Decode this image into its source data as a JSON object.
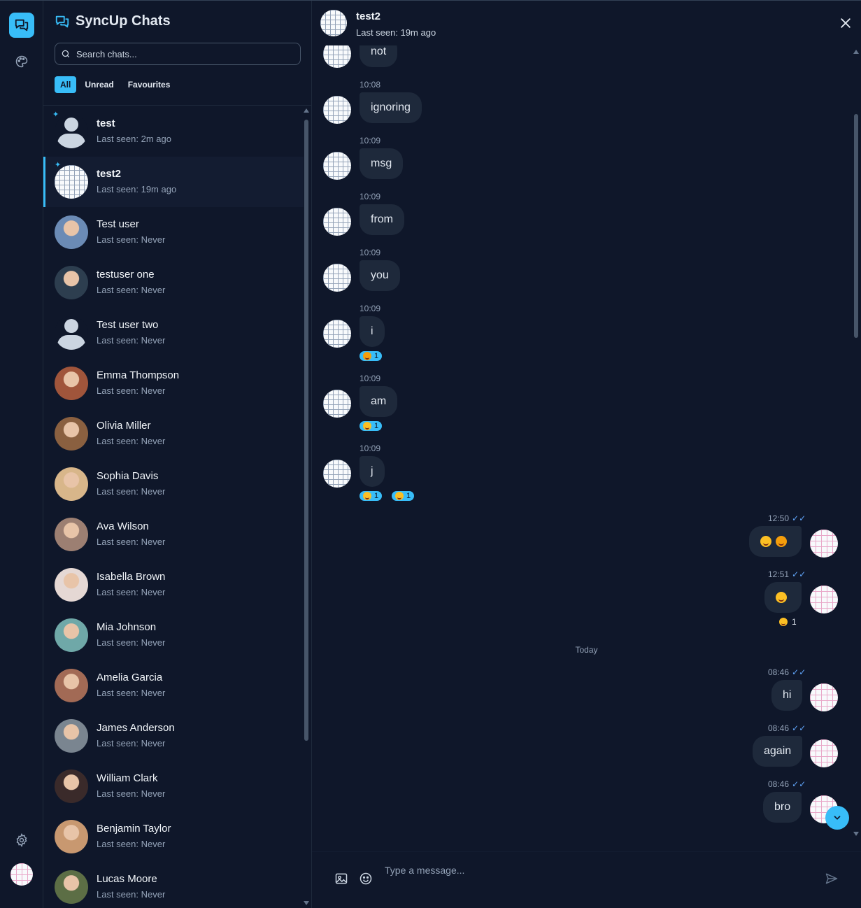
{
  "rail": {
    "items": [
      "chats-icon",
      "palette-icon",
      "settings-icon"
    ]
  },
  "sidebar": {
    "title": "SyncUp Chats",
    "search_placeholder": "Search chats...",
    "filters": [
      "All",
      "Unread",
      "Favourites"
    ],
    "chats": [
      {
        "name": "test",
        "seen": "Last seen: 2m ago",
        "pinned": true,
        "bold": true,
        "avatar": "default"
      },
      {
        "name": "test2",
        "seen": "Last seen: 19m ago",
        "pinned": true,
        "bold": true,
        "avatar": "grid",
        "selected": true
      },
      {
        "name": "Test user",
        "seen": "Last seen: Never",
        "avatar": "photo",
        "color": "#6b8bb5"
      },
      {
        "name": "testuser one",
        "seen": "Last seen: Never",
        "avatar": "photo",
        "color": "#2d3e4f"
      },
      {
        "name": "Test user two",
        "seen": "Last seen: Never",
        "avatar": "default"
      },
      {
        "name": "Emma Thompson",
        "seen": "Last seen: Never",
        "avatar": "photo",
        "color": "#a0553b"
      },
      {
        "name": "Olivia Miller",
        "seen": "Last seen: Never",
        "avatar": "photo",
        "color": "#8a6040"
      },
      {
        "name": "Sophia Davis",
        "seen": "Last seen: Never",
        "avatar": "photo",
        "color": "#d8b68a"
      },
      {
        "name": "Ava Wilson",
        "seen": "Last seen: Never",
        "avatar": "photo",
        "color": "#9c7f72"
      },
      {
        "name": "Isabella Brown",
        "seen": "Last seen: Never",
        "avatar": "photo",
        "color": "#e5d8d4"
      },
      {
        "name": "Mia Johnson",
        "seen": "Last seen: Never",
        "avatar": "photo",
        "color": "#6fa8a8"
      },
      {
        "name": "Amelia Garcia",
        "seen": "Last seen: Never",
        "avatar": "photo",
        "color": "#a26a55"
      },
      {
        "name": "James Anderson",
        "seen": "Last seen: Never",
        "avatar": "photo",
        "color": "#7a8590"
      },
      {
        "name": "William Clark",
        "seen": "Last seen: Never",
        "avatar": "photo",
        "color": "#3a2a2a"
      },
      {
        "name": "Benjamin Taylor",
        "seen": "Last seen: Never",
        "avatar": "photo",
        "color": "#c89870"
      },
      {
        "name": "Lucas Moore",
        "seen": "Last seen: Never",
        "avatar": "photo",
        "color": "#5c6e45"
      }
    ]
  },
  "conversation": {
    "name": "test2",
    "seen": "Last seen: 19m ago",
    "day_separator": "Today",
    "composer_placeholder": "Type a message...",
    "incoming": [
      {
        "text": "not"
      },
      {
        "time": "10:08",
        "text": "ignoring"
      },
      {
        "time": "10:09",
        "text": "msg"
      },
      {
        "time": "10:09",
        "text": "from"
      },
      {
        "time": "10:09",
        "text": "you"
      },
      {
        "time": "10:09",
        "text": "i",
        "reactions": [
          {
            "emoji": "kiss-emoji",
            "count": "1"
          }
        ]
      },
      {
        "time": "10:09",
        "text": "am",
        "reactions": [
          {
            "emoji": "thumbs-up-emoji",
            "count": "1"
          }
        ]
      },
      {
        "time": "10:09",
        "text": "j",
        "reactions": [
          {
            "emoji": "thumbs-up-emoji",
            "count": "1"
          },
          {
            "emoji": "grimace-emoji",
            "count": "1"
          }
        ]
      }
    ],
    "outgoing": [
      {
        "time": "12:50",
        "emojis": [
          "grin-emoji",
          "kiss-emoji"
        ]
      },
      {
        "time": "12:51",
        "emojis": [
          "angel-emoji"
        ],
        "reaction_count": "1"
      },
      {
        "time": "08:46",
        "text": "hi"
      },
      {
        "time": "08:46",
        "text": "again"
      },
      {
        "time": "08:46",
        "text": "bro"
      }
    ]
  }
}
